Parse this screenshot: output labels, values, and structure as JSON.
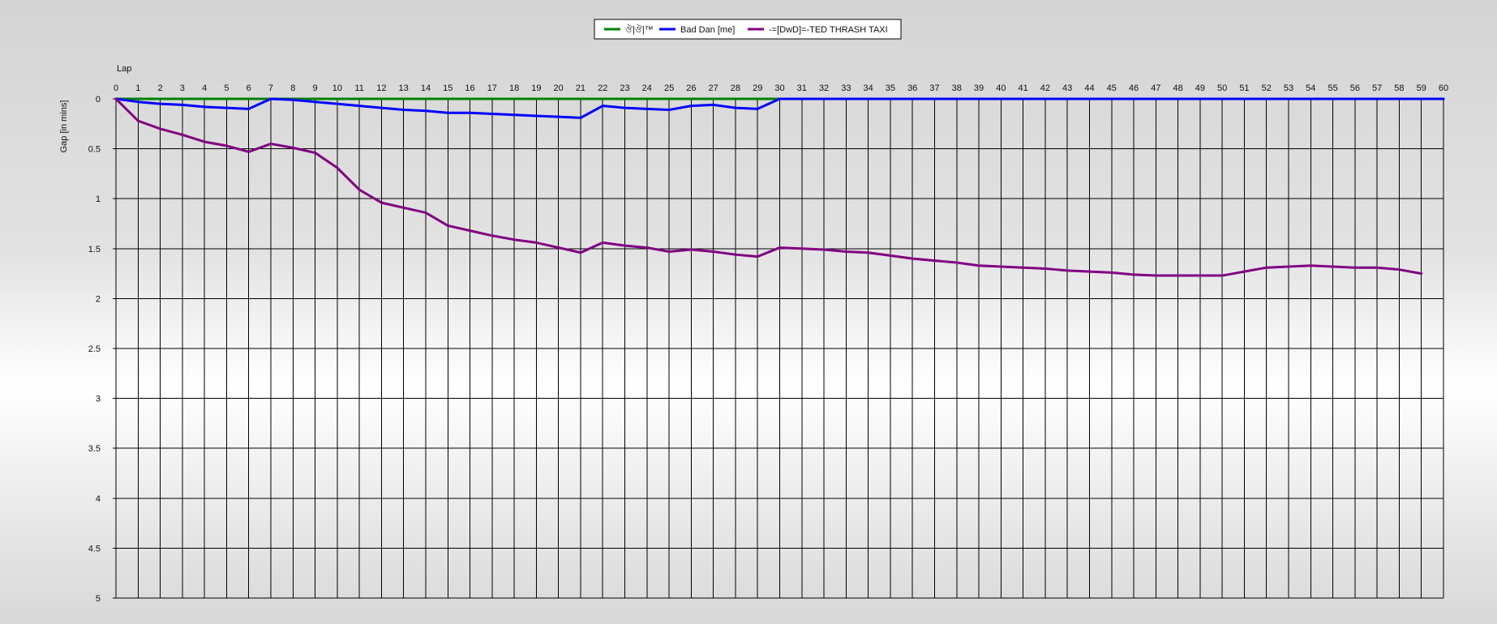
{
  "chart_data": {
    "type": "line",
    "title": "",
    "xlabel": "Lap",
    "ylabel": "Gap [in mins]",
    "xlim": [
      0,
      60
    ],
    "ylim": [
      0,
      5
    ],
    "y_inverted": true,
    "grid": true,
    "legend_placement": "top-center",
    "x_ticks": [
      0,
      1,
      2,
      3,
      4,
      5,
      6,
      7,
      8,
      9,
      10,
      11,
      12,
      13,
      14,
      15,
      16,
      17,
      18,
      19,
      20,
      21,
      22,
      23,
      24,
      25,
      26,
      27,
      28,
      29,
      30,
      31,
      32,
      33,
      34,
      35,
      36,
      37,
      38,
      39,
      40,
      41,
      42,
      43,
      44,
      45,
      46,
      47,
      48,
      49,
      50,
      51,
      52,
      53,
      54,
      55,
      56,
      57,
      58,
      59,
      60
    ],
    "y_ticks": [
      {
        "value": 0,
        "label": "0"
      },
      {
        "value": 0.5,
        "label": "0.5"
      },
      {
        "value": 1,
        "label": "1"
      },
      {
        "value": 1.5,
        "label": "1.5"
      },
      {
        "value": 2,
        "label": "2"
      },
      {
        "value": 2.5,
        "label": "2.5"
      },
      {
        "value": 3,
        "label": "3"
      },
      {
        "value": 3.5,
        "label": "3.5"
      },
      {
        "value": 4,
        "label": "4"
      },
      {
        "value": 4.5,
        "label": "4.5"
      },
      {
        "value": 5,
        "label": "5"
      }
    ],
    "series": [
      {
        "name": "ঔ|ঔ|™",
        "color": "#008000",
        "x": [
          0,
          30
        ],
        "y": [
          0,
          0
        ]
      },
      {
        "name": "Bad Dan [me]",
        "color": "#0000ff",
        "x": [
          0,
          1,
          2,
          3,
          4,
          5,
          6,
          7,
          8,
          9,
          10,
          11,
          12,
          13,
          14,
          15,
          16,
          17,
          18,
          19,
          20,
          21,
          22,
          23,
          24,
          25,
          26,
          27,
          28,
          29,
          30,
          31,
          32,
          33,
          34,
          35,
          36,
          37,
          38,
          39,
          40,
          41,
          42,
          43,
          44,
          45,
          46,
          47,
          48,
          49,
          50,
          51,
          52,
          53,
          54,
          55,
          56,
          57,
          58,
          59,
          60
        ],
        "y": [
          0,
          0.03,
          0.05,
          0.06,
          0.08,
          0.09,
          0.1,
          0,
          0.01,
          0.03,
          0.05,
          0.07,
          0.09,
          0.11,
          0.12,
          0.14,
          0.14,
          0.15,
          0.16,
          0.17,
          0.18,
          0.19,
          0.07,
          0.09,
          0.1,
          0.11,
          0.07,
          0.06,
          0.09,
          0.1,
          0,
          0,
          0,
          0,
          0,
          0,
          0,
          0,
          0,
          0,
          0,
          0,
          0,
          0,
          0,
          0,
          0,
          0,
          0,
          0,
          0,
          0,
          0,
          0,
          0,
          0,
          0,
          0,
          0,
          0,
          0
        ]
      },
      {
        "name": "-=[DwD]=-TED THRASH TAXI",
        "color": "#800080",
        "x": [
          0,
          1,
          2,
          3,
          4,
          5,
          6,
          7,
          8,
          9,
          10,
          11,
          12,
          13,
          14,
          15,
          16,
          17,
          18,
          19,
          20,
          21,
          22,
          23,
          24,
          25,
          26,
          27,
          28,
          29,
          30,
          31,
          32,
          33,
          34,
          35,
          36,
          37,
          38,
          39,
          40,
          41,
          42,
          43,
          44,
          45,
          46,
          47,
          48,
          49,
          50,
          51,
          52,
          53,
          54,
          55,
          56,
          57,
          58,
          59
        ],
        "y": [
          0,
          0.22,
          0.3,
          0.36,
          0.43,
          0.47,
          0.53,
          0.45,
          0.49,
          0.54,
          0.69,
          0.91,
          1.04,
          1.09,
          1.14,
          1.27,
          1.32,
          1.37,
          1.41,
          1.44,
          1.49,
          1.54,
          1.44,
          1.47,
          1.49,
          1.53,
          1.51,
          1.53,
          1.56,
          1.58,
          1.49,
          1.5,
          1.51,
          1.53,
          1.54,
          1.57,
          1.6,
          1.62,
          1.64,
          1.67,
          1.68,
          1.69,
          1.7,
          1.72,
          1.73,
          1.74,
          1.76,
          1.77,
          1.77,
          1.77,
          1.77,
          1.73,
          1.69,
          1.68,
          1.67,
          1.68,
          1.69,
          1.69,
          1.71,
          1.75
        ]
      }
    ]
  }
}
